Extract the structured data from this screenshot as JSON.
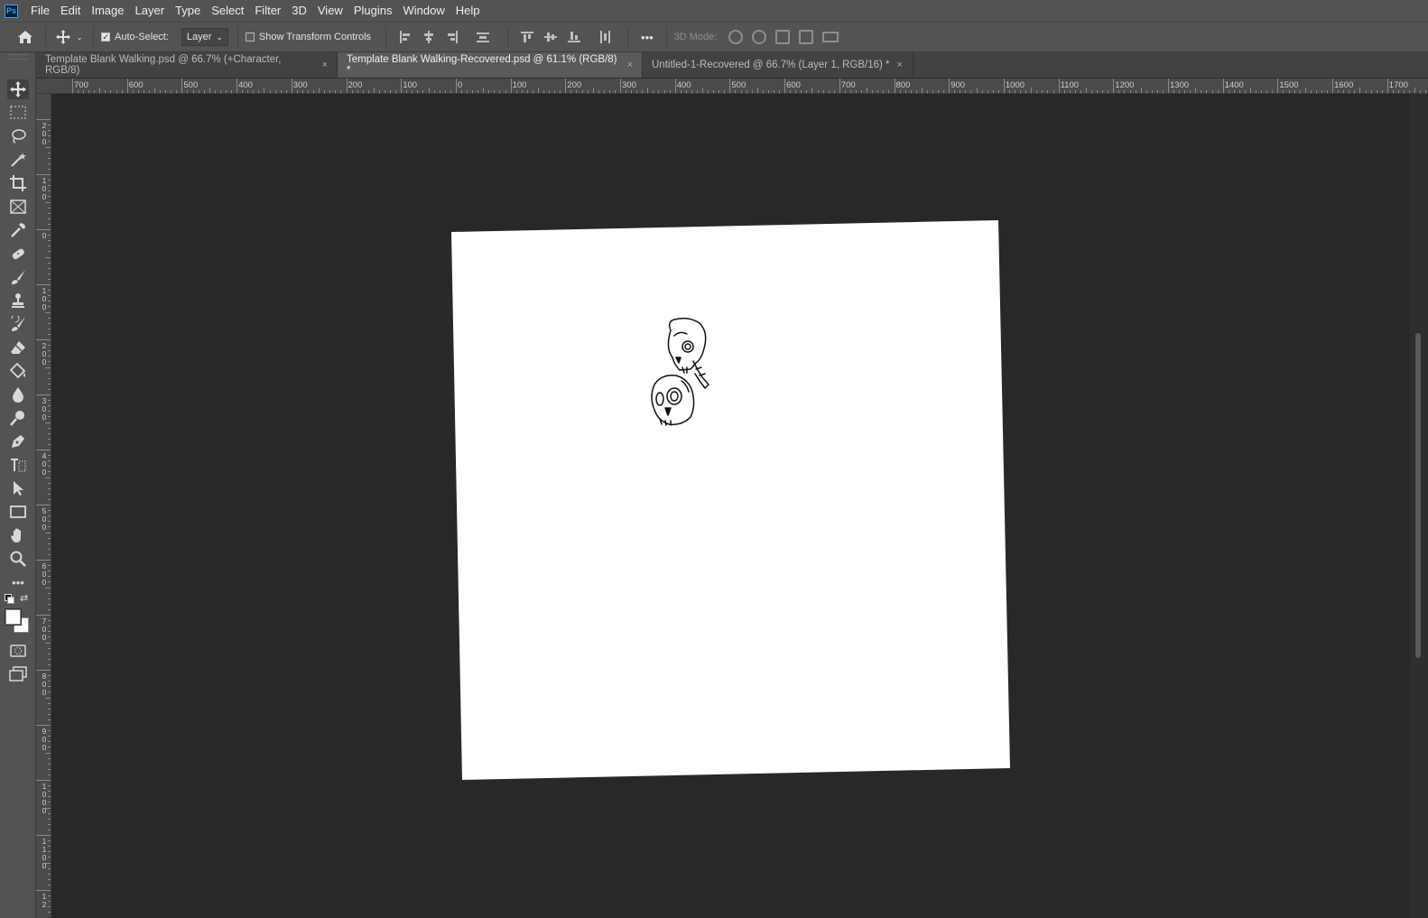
{
  "app": {
    "logo": "Ps"
  },
  "menu": [
    "File",
    "Edit",
    "Image",
    "Layer",
    "Type",
    "Select",
    "Filter",
    "3D",
    "View",
    "Plugins",
    "Window",
    "Help"
  ],
  "options": {
    "auto_select_label": "Auto-Select:",
    "auto_select_checked": true,
    "auto_select_target": "Layer",
    "show_transform_label": "Show Transform Controls",
    "show_transform_checked": false,
    "more_label": "•••",
    "mode_label": "3D Mode:"
  },
  "tabs": [
    {
      "title": "Template Blank Walking.psd @ 66.7% (+Character, RGB/8)",
      "active": false
    },
    {
      "title": "Template Blank Walking-Recovered.psd @ 61.1% (RGB/8) *",
      "active": true
    },
    {
      "title": "Untitled-1-Recovered @ 66.7% (Layer 1, RGB/16) *",
      "active": false
    }
  ],
  "tab_close": "×",
  "panel_collapse": "»",
  "ruler_top_labels": [
    "700",
    "600",
    "500",
    "400",
    "300",
    "200",
    "100",
    "0",
    "100",
    "200",
    "300",
    "400",
    "500",
    "600",
    "700",
    "800",
    "900",
    "1000",
    "1100",
    "1200",
    "1300",
    "1400",
    "1500",
    "1600",
    "1700"
  ],
  "ruler_left_labels": [
    "2 0 0",
    "1 0 0",
    "0",
    "1 0 0",
    "2 0 0",
    "3 0 0",
    "4 0 0",
    "5 0 0",
    "6 0 0",
    "7 0 0",
    "8 0 0",
    "9 0 0",
    "1 0 0 0",
    "1 1 0 0",
    "1 2"
  ],
  "toolbar_more": "•••",
  "colors": {
    "foreground": "#ffffff",
    "background": "#ffffff",
    "canvas": "#ffffff",
    "workspace": "#282828"
  }
}
